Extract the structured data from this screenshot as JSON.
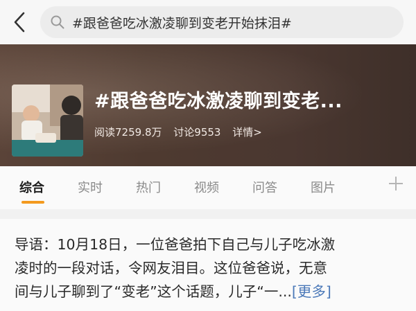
{
  "search": {
    "query": "#跟爸爸吃冰激凌聊到变老开始抹泪#"
  },
  "topic": {
    "title": "#跟爸爸吃冰激凌聊到变老...",
    "reads": "阅读7259.8万",
    "discussions": "讨论9553",
    "details_label": "详情>"
  },
  "tabs": [
    {
      "label": "综合",
      "active": true
    },
    {
      "label": "实时",
      "active": false
    },
    {
      "label": "热门",
      "active": false
    },
    {
      "label": "视频",
      "active": false
    },
    {
      "label": "问答",
      "active": false
    },
    {
      "label": "图片",
      "active": false
    }
  ],
  "intro": {
    "line1": "导语：10月18日，一位爸爸拍下自己与儿子吃冰激",
    "line2": "凌时的一段对话，令网友泪目。这位爸爸说，无意",
    "line3": "间与儿子聊到了“变老”这个话题，儿子“一...",
    "more_label": "[更多]"
  },
  "colors": {
    "accent": "#f39a1f",
    "link": "#4a78b8"
  }
}
